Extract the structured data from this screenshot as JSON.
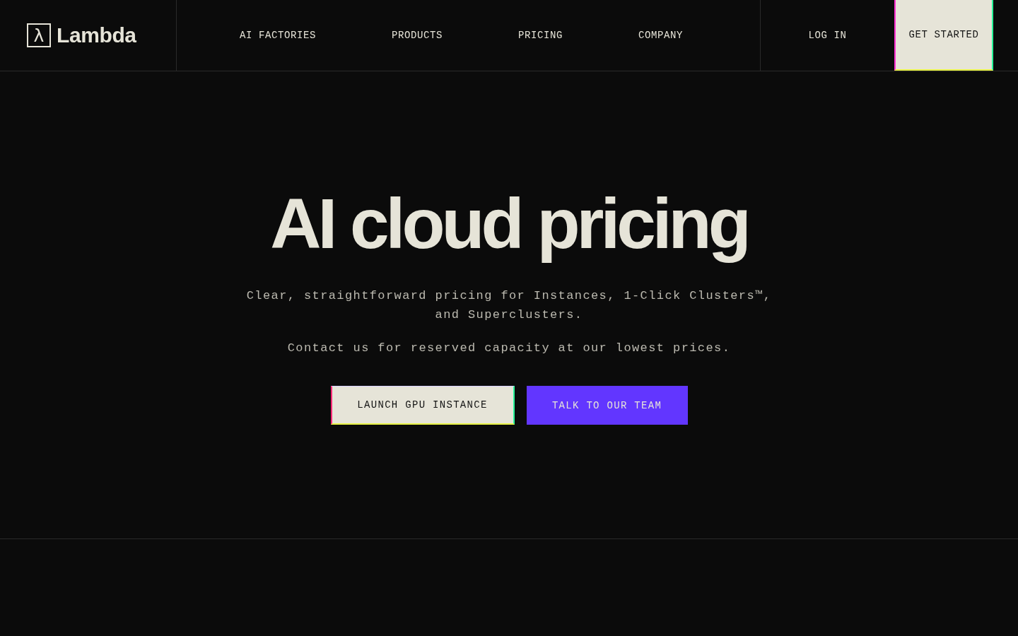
{
  "header": {
    "logo": {
      "mark": "λ",
      "text": "Lambda"
    },
    "nav": [
      {
        "label": "AI FACTORIES"
      },
      {
        "label": "PRODUCTS"
      },
      {
        "label": "PRICING"
      },
      {
        "label": "COMPANY"
      }
    ],
    "login": "LOG IN",
    "cta": "GET STARTED"
  },
  "hero": {
    "title": "AI cloud pricing",
    "subtitle": "Clear, straightforward pricing for Instances, 1-Click Clusters™, and Superclusters.",
    "note": "Contact us for reserved capacity at our lowest prices.",
    "buttons": [
      {
        "label": "LAUNCH GPU INSTANCE",
        "kind": "light"
      },
      {
        "label": "TALK TO OUR TEAM",
        "kind": "accent"
      }
    ]
  }
}
